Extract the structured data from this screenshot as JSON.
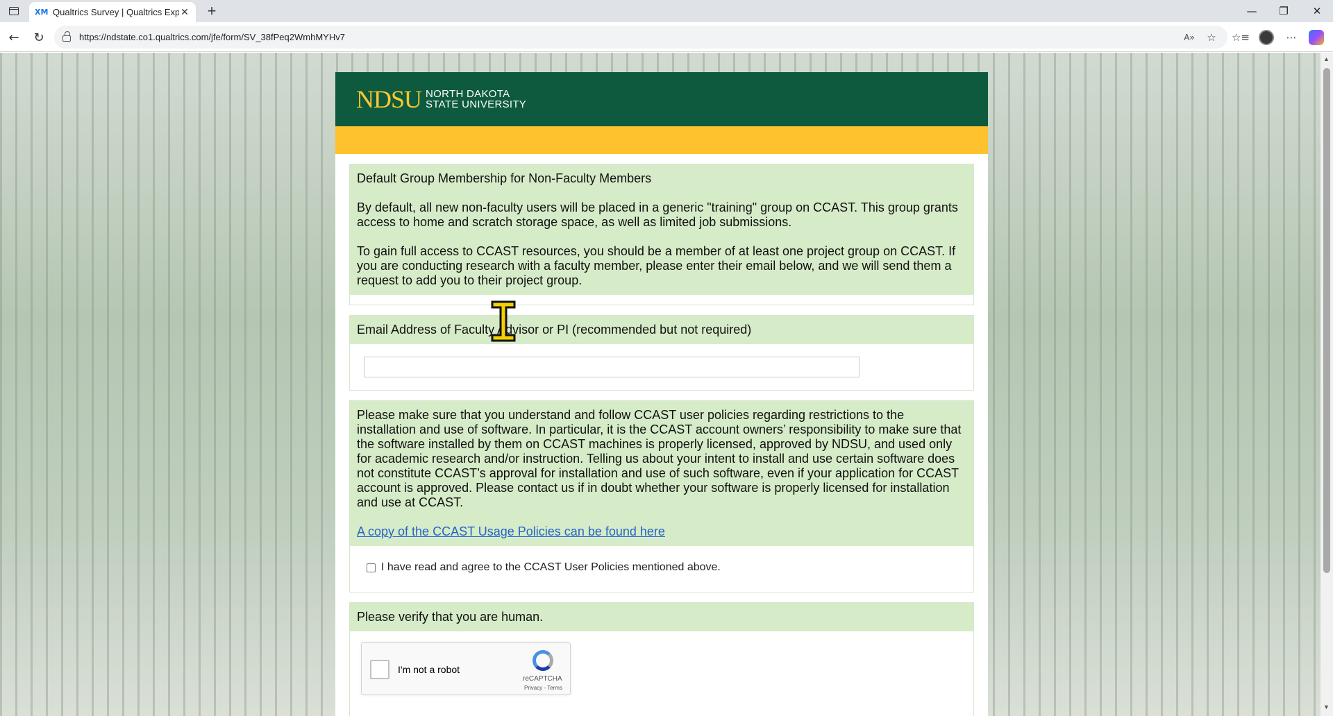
{
  "browser": {
    "tab_title": "Qualtrics Survey | Qualtrics Experi",
    "tab_favicon": "XM",
    "url": "https://ndstate.co1.qualtrics.com/jfe/form/SV_38fPeq2WmhMYHv7"
  },
  "colors": {
    "brand_green": "#0e5a3e",
    "brand_gold": "#fdc22d",
    "question_header_bg": "#d6ebc8",
    "link": "#2565c7"
  },
  "banner": {
    "logo_main": "NDSU",
    "logo_line1": "NORTH DAKOTA",
    "logo_line2": "STATE UNIVERSITY"
  },
  "q1": {
    "title": "Default Group Membership for Non-Faculty Members",
    "para1": "By default, all new non-faculty users will be placed in a generic \"training\" group on CCAST. This group grants access to home and scratch storage space, as well as limited job submissions.",
    "para2": "To gain full access to CCAST resources, you should be a member of at least one project group on CCAST. If you are conducting research with a faculty member, please enter their email below, and we will send them a request to add you to their project group."
  },
  "q2": {
    "title": "Email Address of Faculty Advisor or PI (recommended but not required)",
    "value": ""
  },
  "q3": {
    "text": "Please make sure that you understand and follow CCAST user policies regarding restrictions to the installation and use of software. In particular, it is the CCAST account owners’ responsibility to make sure that the software installed by them on CCAST machines is properly licensed, approved by NDSU, and used only for academic research and/or instruction. Telling us about your intent to install and use certain software does not constitute CCAST’s approval for installation and use of such software, even if your application for CCAST account is approved. Please contact us if in doubt whether your software is properly licensed for installation and use at CCAST.",
    "link_text": "A copy of the CCAST Usage Policies can be found here",
    "checkbox_label": "I have read and agree to the CCAST User Policies mentioned above.",
    "checked": false
  },
  "q4": {
    "title": "Please verify that you are human.",
    "recaptcha_label": "I'm not a robot",
    "recaptcha_name": "reCAPTCHA",
    "recaptcha_terms": "Privacy - Terms"
  }
}
